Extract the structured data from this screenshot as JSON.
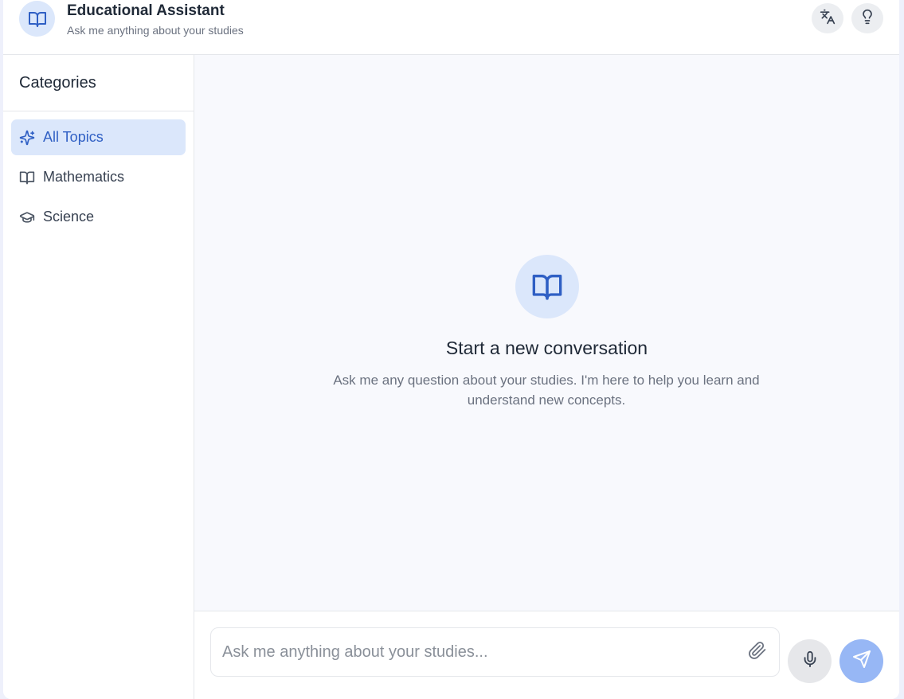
{
  "header": {
    "title": "Educational Assistant",
    "subtitle": "Ask me anything about your studies",
    "logo_icon": "book-open-icon",
    "translate_icon": "translate-icon",
    "tips_icon": "lightbulb-icon"
  },
  "sidebar": {
    "title": "Categories",
    "items": [
      {
        "label": "All Topics",
        "icon": "sparkles-icon",
        "active": true
      },
      {
        "label": "Mathematics",
        "icon": "book-icon",
        "active": false
      },
      {
        "label": "Science",
        "icon": "graduation-cap-icon",
        "active": false
      }
    ]
  },
  "main": {
    "empty_title": "Start a new conversation",
    "empty_description": "Ask me any question about your studies. I'm here to help you learn and understand new concepts."
  },
  "composer": {
    "placeholder": "Ask me anything about your studies...",
    "value": ""
  },
  "colors": {
    "accent": "#2f5fc4",
    "accent_light": "#dbe7fb",
    "send_button": "#97b7f5",
    "main_background": "#f8f9fd"
  }
}
